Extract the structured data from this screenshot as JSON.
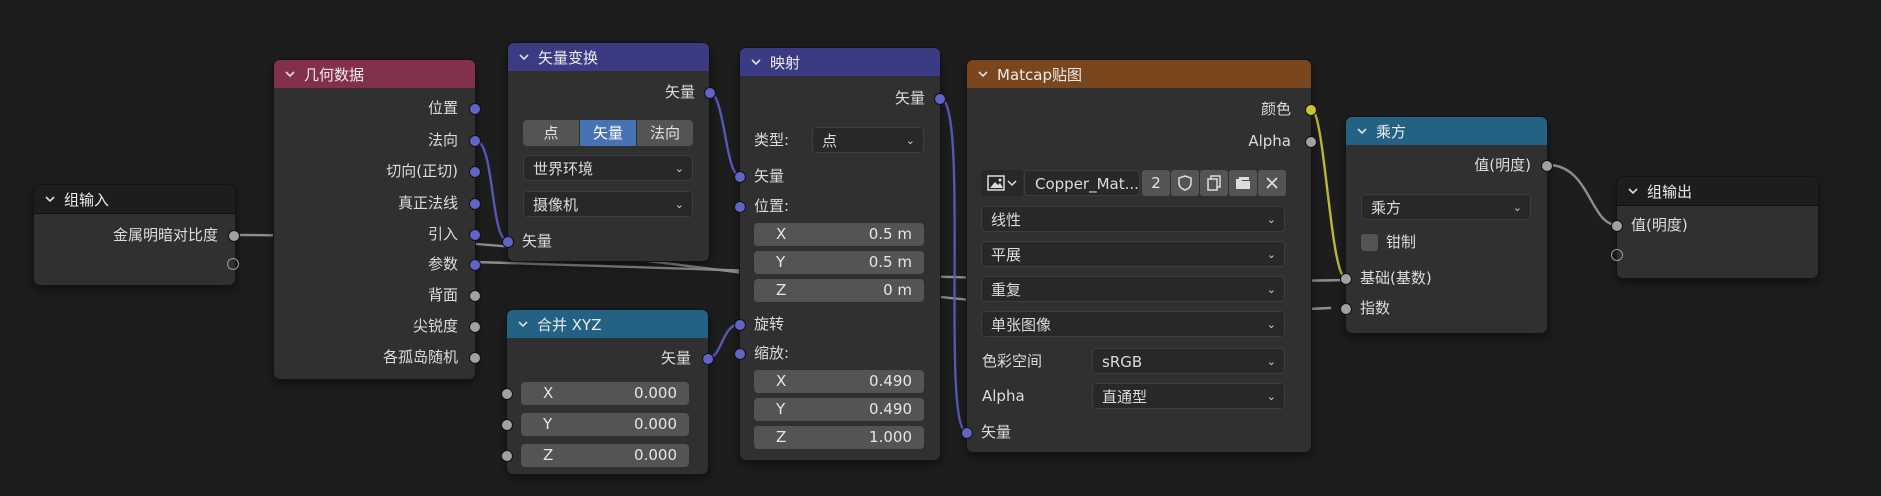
{
  "colors": {
    "background": "#1d1d1d",
    "node_body": "#303030",
    "header_group": "#1d1d1d",
    "header_geometry": "#83314a",
    "header_vector": "#3b3b83",
    "header_combine": "#246283",
    "header_texture": "#79461d",
    "header_math": "#246283",
    "socket_vector": "#6363c7",
    "socket_float": "#a1a1a1",
    "socket_color": "#c7c729",
    "active_button": "#4772b3"
  },
  "group_input": {
    "title": "组输入",
    "outputs": [
      "金属明暗对比度"
    ]
  },
  "geometry": {
    "title": "几何数据",
    "outputs": [
      "位置",
      "法向",
      "切向(正切)",
      "真正法线",
      "引入",
      "参数",
      "背面",
      "尖锐度",
      "各孤岛随机"
    ]
  },
  "vector_transform": {
    "title": "矢量变换",
    "output": "矢量",
    "type_options": [
      "点",
      "矢量",
      "法向"
    ],
    "type_selected": "矢量",
    "convert_from": "世界环境",
    "convert_to": "摄像机",
    "input": "矢量"
  },
  "combine_xyz": {
    "title": "合并 XYZ",
    "output": "矢量",
    "fields": [
      {
        "label": "X",
        "value": "0.000"
      },
      {
        "label": "Y",
        "value": "0.000"
      },
      {
        "label": "Z",
        "value": "0.000"
      }
    ]
  },
  "mapping": {
    "title": "映射",
    "output": "矢量",
    "type_label": "类型:",
    "type_value": "点",
    "input_vector": "矢量",
    "location_label": "位置:",
    "location": [
      {
        "label": "X",
        "value": "0.5 m"
      },
      {
        "label": "Y",
        "value": "0.5 m"
      },
      {
        "label": "Z",
        "value": "0 m"
      }
    ],
    "rotation_label": "旋转",
    "scale_label": "缩放:",
    "scale": [
      {
        "label": "X",
        "value": "0.490"
      },
      {
        "label": "Y",
        "value": "0.490"
      },
      {
        "label": "Z",
        "value": "1.000"
      }
    ]
  },
  "image_texture": {
    "title": "Matcap贴图",
    "outputs": [
      "颜色",
      "Alpha"
    ],
    "image_name": "Copper_Mat...",
    "users": "2",
    "interpolation": "线性",
    "projection": "平展",
    "extension": "重复",
    "source": "单张图像",
    "color_space_label": "色彩空间",
    "color_space_value": "sRGB",
    "alpha_label": "Alpha",
    "alpha_value": "直通型",
    "input": "矢量"
  },
  "power": {
    "title": "乘方",
    "output": "值(明度)",
    "operation": "乘方",
    "clamp_label": "钳制",
    "clamp": false,
    "inputs": [
      "基础(基数)",
      "指数"
    ]
  },
  "group_output": {
    "title": "组输出",
    "inputs": [
      "值(明度)"
    ]
  }
}
